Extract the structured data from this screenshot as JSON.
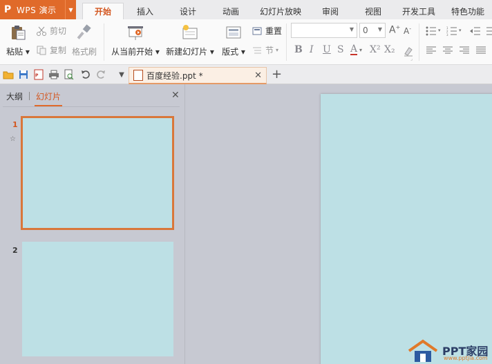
{
  "app": {
    "name": "WPS 演示",
    "logo_glyph": "P",
    "accent": "#e06a2a"
  },
  "menu_tabs": [
    "开始",
    "插入",
    "设计",
    "动画",
    "幻灯片放映",
    "审阅",
    "视图",
    "开发工具",
    "特色功能"
  ],
  "active_tab": "开始",
  "ribbon": {
    "paste": "粘贴",
    "cut": "剪切",
    "copy": "复制",
    "format_painter": "格式刷",
    "from_current": "从当前开始",
    "new_slide": "新建幻灯片",
    "layout": "版式",
    "reset": "重置",
    "section": "节",
    "font_size_value": "0",
    "font_name_value": "",
    "format_buttons": [
      "B",
      "I",
      "U",
      "S",
      "A",
      "X²",
      "X₂"
    ]
  },
  "document": {
    "title": "百度经验.ppt *"
  },
  "panel": {
    "tab_outline": "大纲",
    "tab_slides": "幻灯片"
  },
  "slides": [
    {
      "number": "1",
      "selected": true,
      "has_animation": true
    },
    {
      "number": "2",
      "selected": false,
      "has_animation": false
    }
  ],
  "colors": {
    "slide_bg": "#bde0e5",
    "workspace_bg": "#c7c9d2",
    "selection": "#d9773a"
  },
  "watermark": {
    "text": "PPT家园",
    "url": "www.pptjia.com"
  }
}
